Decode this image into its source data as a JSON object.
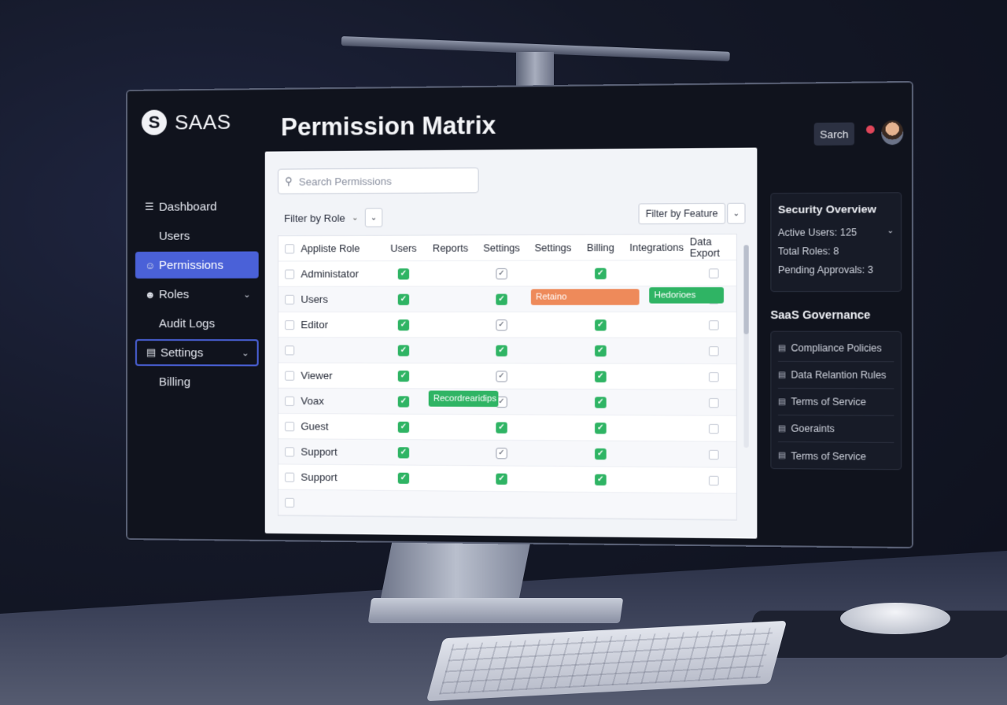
{
  "brand": {
    "logo": "S",
    "name": "SAAS"
  },
  "page_title": "Permission Matrix",
  "topbar": {
    "search_label": "Sarch"
  },
  "sidebar": {
    "items": [
      {
        "label": "Dashboard",
        "icon": "menu-icon"
      },
      {
        "label": "Users"
      },
      {
        "label": "Permissions",
        "icon": "user-icon",
        "active": true
      },
      {
        "label": "Roles",
        "icon": "users-icon"
      },
      {
        "label": "Audit Logs"
      },
      {
        "label": "Settings",
        "icon": "settings-icon"
      },
      {
        "label": "Billing"
      }
    ]
  },
  "main": {
    "search_placeholder": "Search Permissions",
    "filter_role_label": "Filter by Role",
    "filter_feature_label": "Filter by Feature",
    "columns": [
      "Appliste Role",
      "Users",
      "Reports",
      "Settings",
      "Settings",
      "Billing",
      "Integrations",
      "Data Export"
    ],
    "rows": [
      {
        "role": "Administator",
        "cells": [
          "green",
          "",
          "gray",
          "",
          "green",
          "",
          "cb"
        ]
      },
      {
        "role": "Users",
        "cells": [
          "green",
          "",
          "green",
          "",
          "green",
          "",
          "cb"
        ]
      },
      {
        "role": "Editor",
        "cells": [
          "green",
          "",
          "gray",
          "",
          "green",
          "",
          "cb"
        ]
      },
      {
        "role": "",
        "cells": [
          "green",
          "",
          "green",
          "",
          "green",
          "",
          "cb"
        ]
      },
      {
        "role": "Viewer",
        "cells": [
          "green",
          "",
          "gray",
          "",
          "green",
          "",
          "cb"
        ]
      },
      {
        "role": "Voax",
        "cells": [
          "green",
          "",
          "gray",
          "",
          "green",
          "",
          "cb"
        ]
      },
      {
        "role": "Guest",
        "cells": [
          "green",
          "",
          "green",
          "",
          "green",
          "",
          "cb"
        ]
      },
      {
        "role": "Support",
        "cells": [
          "green",
          "",
          "gray",
          "",
          "green",
          "",
          "cb"
        ]
      },
      {
        "role": "Support",
        "cells": [
          "green",
          "",
          "green",
          "",
          "green",
          "",
          "cb"
        ]
      },
      {
        "role": "",
        "cells": [
          "",
          "",
          "",
          "",
          "",
          "",
          ""
        ]
      }
    ],
    "tags": {
      "retention": "Retaino",
      "hedorioes": "Hedorioes",
      "recordings": "Recordrearidips"
    }
  },
  "security_overview": {
    "title": "Security Overview",
    "active_users": "Active Users: 125",
    "total_roles": "Total Roles: 8",
    "pending_approvals": "Pending Approvals: 3"
  },
  "governance": {
    "title": "SaaS Governance",
    "items": [
      "Compliance Policies",
      "Data Relantion Rules",
      "Terms of Service",
      "Goeraints",
      "Terms of Service"
    ]
  }
}
